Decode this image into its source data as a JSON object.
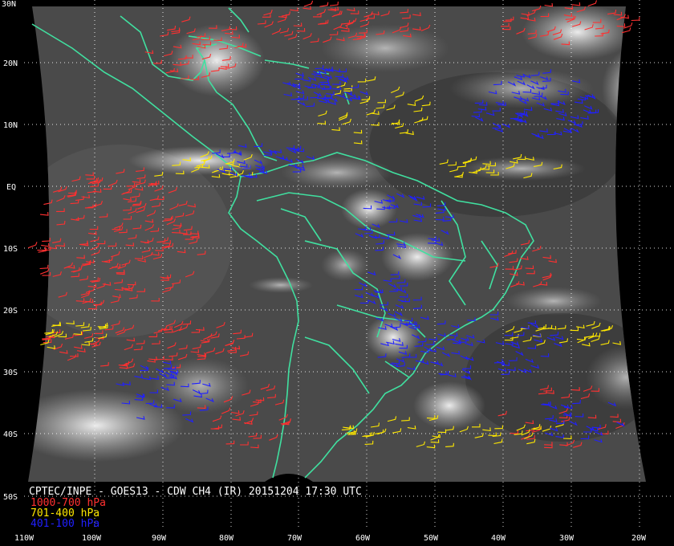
{
  "header": {
    "title": "CPTEC/INPE - GOES13 - CDW CH4 (IR) 20151204 17:30 UTC"
  },
  "legend": [
    {
      "label": "1000-700 hPa",
      "color": "#ff3030"
    },
    {
      "label": "701-400 hPa",
      "color": "#ffe800"
    },
    {
      "label": "401-100 hPa",
      "color": "#2020ff"
    }
  ],
  "axes": {
    "lat_labels": [
      "30N",
      "20N",
      "10N",
      "EQ",
      "10S",
      "20S",
      "30S",
      "40S",
      "50S"
    ],
    "lon_labels": [
      "110W",
      "100W",
      "90W",
      "80W",
      "70W",
      "60W",
      "50W",
      "40W",
      "30W",
      "20W"
    ]
  },
  "colors": {
    "coastline": "#40e0a0",
    "grid": "#ffffff",
    "background": "#000000"
  }
}
